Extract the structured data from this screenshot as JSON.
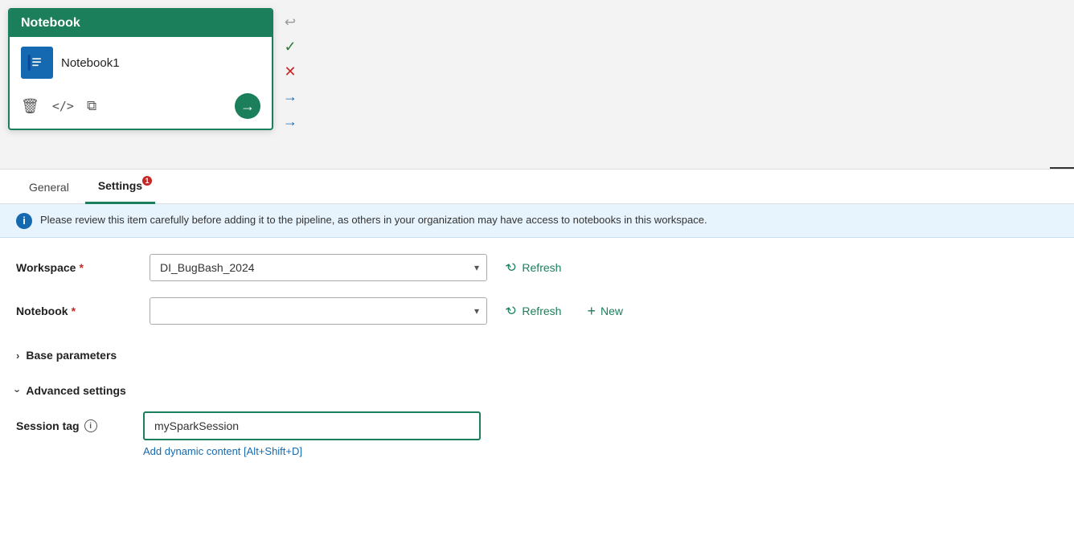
{
  "notebook_card": {
    "header": "Notebook",
    "item_name": "Notebook1",
    "actions": {
      "delete_label": "delete",
      "code_label": "code",
      "copy_label": "copy",
      "go_label": "go"
    }
  },
  "side_toolbar": {
    "undo_label": "undo",
    "check_label": "confirm",
    "cross_label": "cancel",
    "arrow_right_label": "arrow-right",
    "arrow_right2_label": "arrow-right-2"
  },
  "tabs": {
    "general": "General",
    "settings": "Settings",
    "settings_badge": "1"
  },
  "info_banner": {
    "text": "Please review this item carefully before adding it to the pipeline, as others in your organization may have access to notebooks in this workspace."
  },
  "form": {
    "workspace_label": "Workspace",
    "workspace_required": "*",
    "workspace_value": "DI_BugBash_2024",
    "workspace_options": [
      "DI_BugBash_2024"
    ],
    "notebook_label": "Notebook",
    "notebook_required": "*",
    "notebook_value": "",
    "notebook_placeholder": "",
    "refresh_label": "Refresh",
    "refresh_label2": "Refresh",
    "new_label": "New",
    "base_params_label": "Base parameters",
    "advanced_settings_label": "Advanced settings",
    "session_tag_label": "Session tag",
    "session_tag_value": "mySparkSession",
    "session_tag_tooltip": "i",
    "dynamic_content_link": "Add dynamic content [Alt+Shift+D]"
  },
  "icons": {
    "refresh": "↻",
    "plus": "+",
    "delete": "🗑",
    "code": "</>",
    "copy": "⧉",
    "go": "→",
    "check": "✓",
    "cross": "✕",
    "chevron_down": "⌄",
    "expand_right": "›",
    "expand_down": "∨",
    "info": "i",
    "undo": "↩"
  }
}
